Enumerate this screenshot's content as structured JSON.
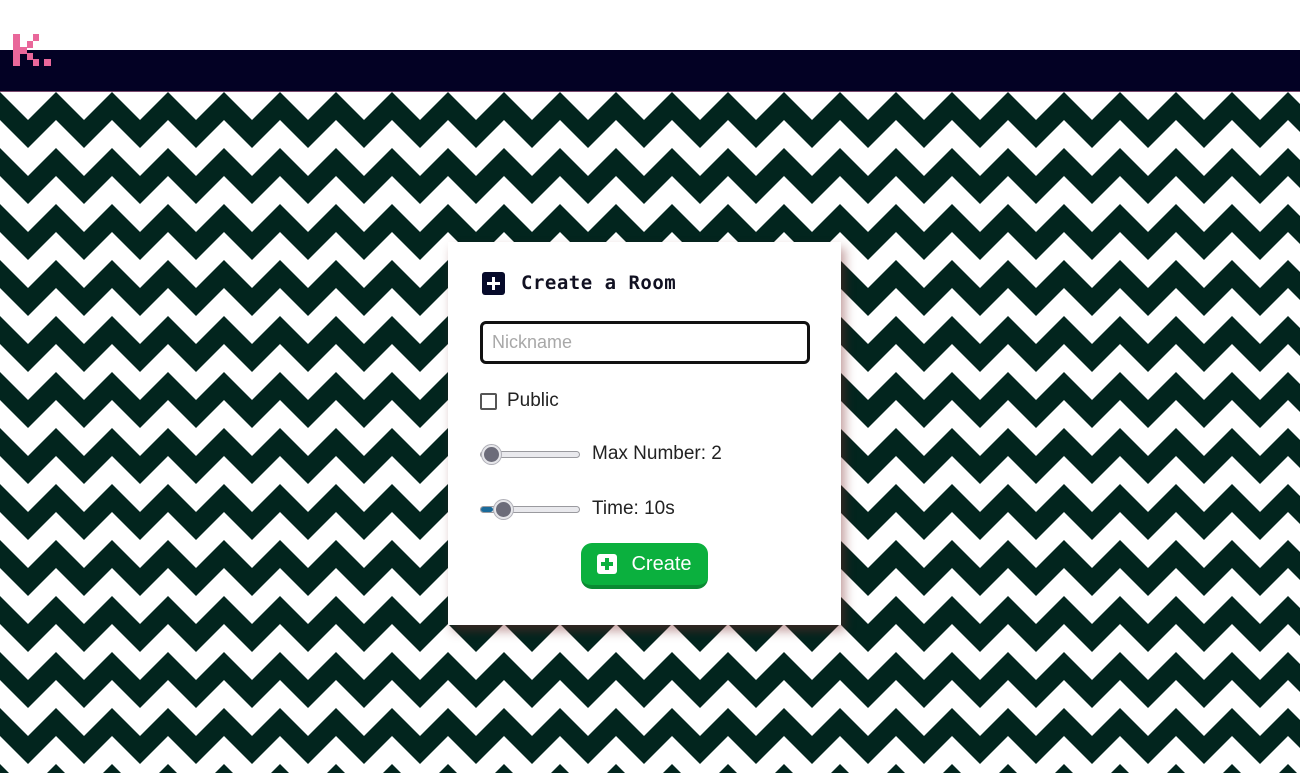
{
  "colors": {
    "navbar": "#030124",
    "logo": "#e9679a",
    "zigzag_dark": "#02251e",
    "zigzag_light": "#ffffff",
    "create_button": "#0bb03e"
  },
  "logo": {
    "text": "K.",
    "icon": "pixel-k-logo"
  },
  "form": {
    "title": "Create a Room",
    "title_icon": "plus-square-icon",
    "nickname": {
      "placeholder": "Nickname",
      "value": ""
    },
    "public": {
      "label": "Public",
      "checked": false
    },
    "max_number": {
      "label": "Max Number: 2",
      "value": 2
    },
    "time": {
      "label": "Time: 10s",
      "value": 10,
      "fill_fraction": 0.12
    },
    "create_button": {
      "label": "Create",
      "icon": "plus-square-icon"
    }
  }
}
